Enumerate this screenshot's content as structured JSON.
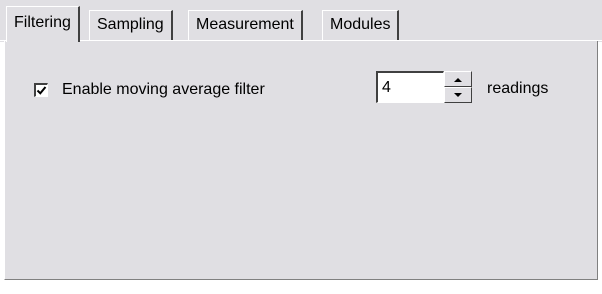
{
  "tabs": [
    {
      "label": "Filtering",
      "active": true
    },
    {
      "label": "Sampling",
      "active": false
    },
    {
      "label": "Measurement",
      "active": false
    },
    {
      "label": "Modules",
      "active": false
    }
  ],
  "filtering": {
    "enable_label": "Enable moving average filter",
    "enable_checked": true,
    "readings_value": "4",
    "readings_unit": "readings"
  },
  "colors": {
    "panel_background": "#e0dfe3",
    "page_background": "#ffffff"
  },
  "icons": {
    "check": "check-icon",
    "spin_up": "arrow-up-icon",
    "spin_down": "arrow-down-icon"
  }
}
